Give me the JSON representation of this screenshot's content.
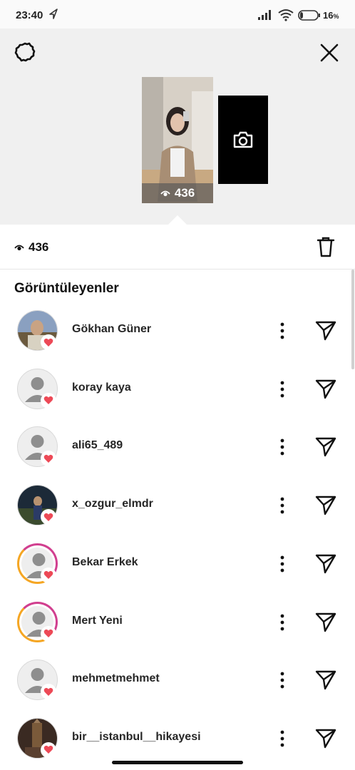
{
  "status_bar": {
    "time": "23:40",
    "battery_percent": "16",
    "battery_unit": "%",
    "icons": [
      "navigation-icon",
      "signal-icon",
      "wifi-icon",
      "battery-icon"
    ]
  },
  "header": {
    "icons": [
      "gear-icon",
      "close-icon",
      "camera-icon"
    ],
    "story_views": "436"
  },
  "views": {
    "count": "436",
    "icons": [
      "eye-icon",
      "trash-icon"
    ]
  },
  "section_title": "Görüntüleyenler",
  "viewers": [
    {
      "username": "Gökhan Güner",
      "avatar": "photo",
      "liked": true
    },
    {
      "username": "koray kaya",
      "avatar": "default",
      "liked": true
    },
    {
      "username": "ali65_489",
      "avatar": "default",
      "liked": true
    },
    {
      "username": "x_ozgur_elmdr",
      "avatar": "photo",
      "liked": true
    },
    {
      "username": "Bekar Erkek",
      "avatar": "default-story-ring",
      "liked": true
    },
    {
      "username": "Mert Yeni",
      "avatar": "default-story-ring",
      "liked": true
    },
    {
      "username": "mehmetmehmet",
      "avatar": "default",
      "liked": true
    },
    {
      "username": "bir__istanbul__hikayesi",
      "avatar": "photo",
      "liked": true
    }
  ],
  "colors": {
    "heart": "#ed4956",
    "story_ring_start": "#d13f8f",
    "story_ring_end": "#f5a623",
    "header_bg": "#f0f0f0"
  }
}
